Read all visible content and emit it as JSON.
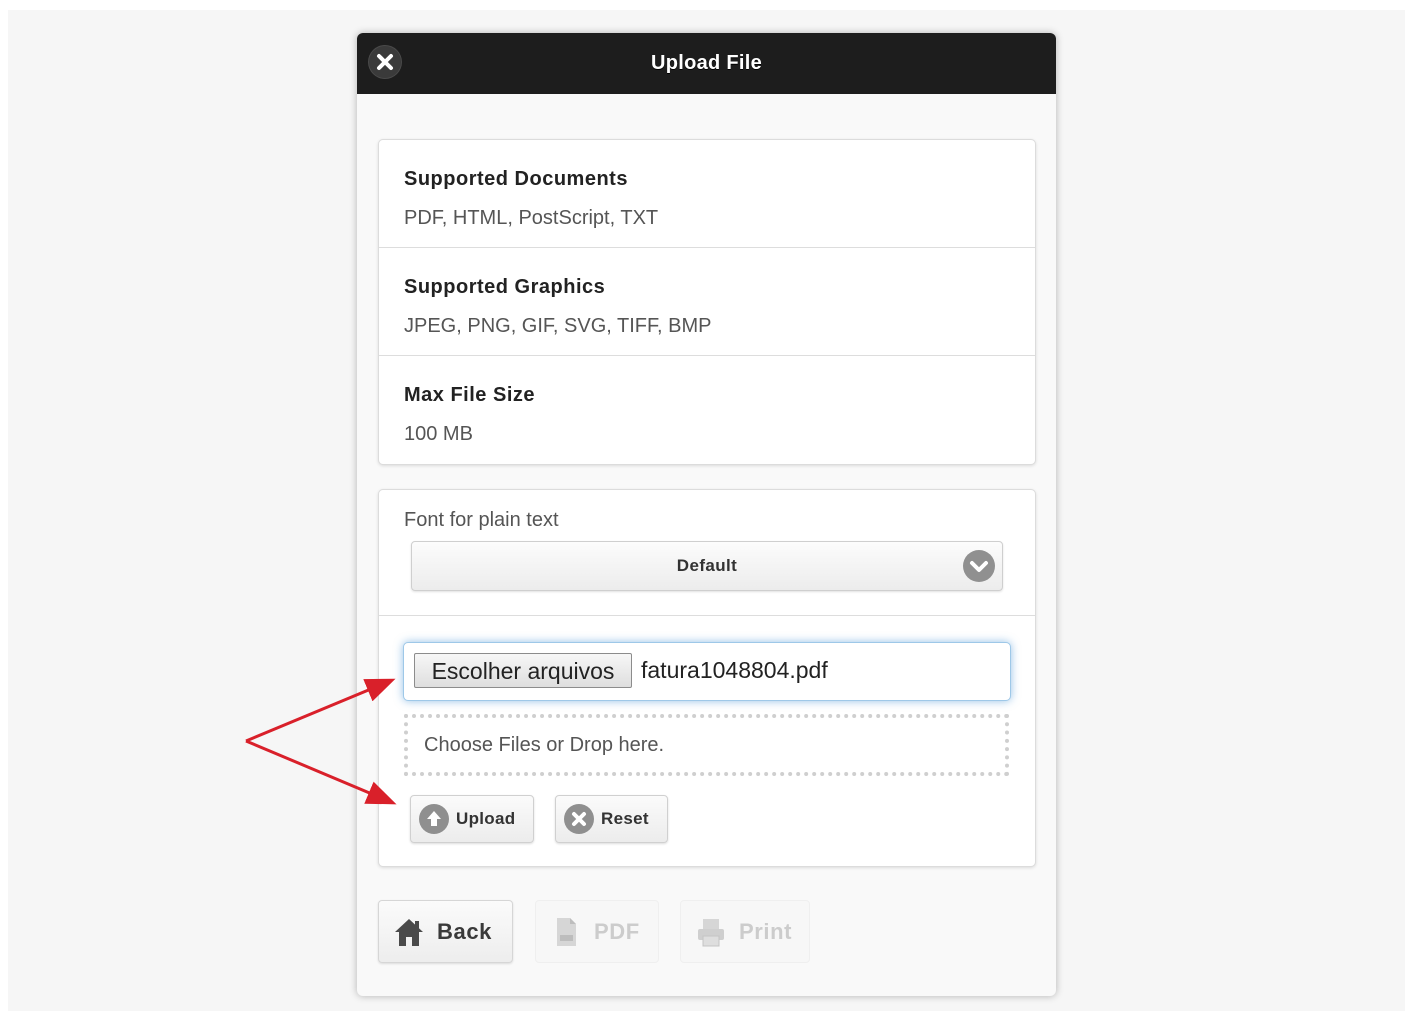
{
  "dialog": {
    "title": "Upload File",
    "close_icon": "close-icon"
  },
  "info": [
    {
      "heading": "Supported Documents",
      "value": "PDF, HTML, PostScript, TXT"
    },
    {
      "heading": "Supported Graphics",
      "value": "JPEG, PNG, GIF, SVG, TIFF, BMP"
    },
    {
      "heading": "Max File Size",
      "value": "100 MB"
    }
  ],
  "font": {
    "label": "Font for plain text",
    "selected": "Default",
    "chevron_icon": "chevron-down-icon"
  },
  "file_input": {
    "button_label": "Escolher arquivos",
    "file_name": "fatura1048804.pdf"
  },
  "drop_zone": {
    "text": "Choose Files or Drop here."
  },
  "actions": {
    "upload_label": "Upload",
    "upload_icon": "arrow-up-circle-icon",
    "reset_label": "Reset",
    "reset_icon": "x-circle-icon"
  },
  "footer": {
    "back_label": "Back",
    "back_icon": "home-icon",
    "pdf_label": "PDF",
    "pdf_icon": "document-icon",
    "print_label": "Print",
    "print_icon": "printer-icon"
  },
  "colors": {
    "header_bg": "#1d1d1d",
    "focus_glow": "#3c8cd2",
    "annotation_arrow": "#d9202a",
    "disabled_text": "#cccccc"
  }
}
